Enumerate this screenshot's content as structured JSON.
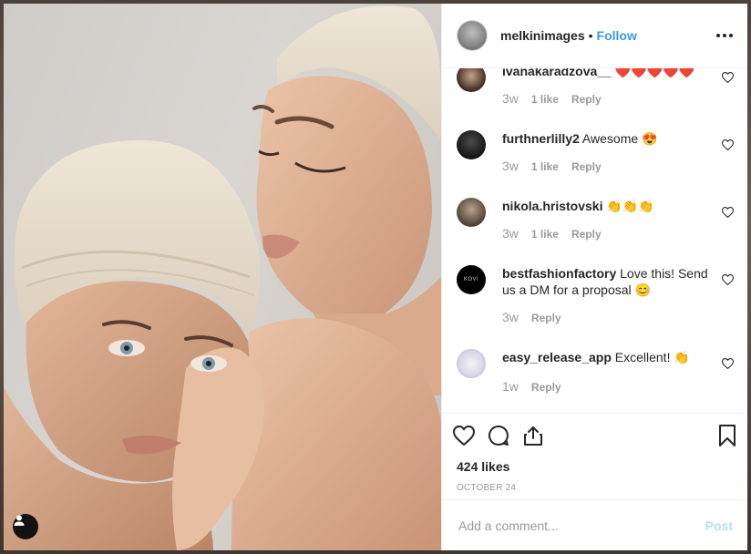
{
  "header": {
    "username": "melkinimages",
    "separator": "•",
    "follow_label": "Follow"
  },
  "comments": [
    {
      "username": "ivanakaradzova__",
      "text": "❤️❤️❤️❤️❤️",
      "time": "3w",
      "likes": "1 like",
      "reply": "Reply"
    },
    {
      "username": "furthnerlilly2",
      "text": "Awesome 😍",
      "time": "3w",
      "likes": "1 like",
      "reply": "Reply"
    },
    {
      "username": "nikola.hristovski",
      "text": "👏👏👏",
      "time": "3w",
      "likes": "1 like",
      "reply": "Reply"
    },
    {
      "username": "bestfashionfactory",
      "text": "Love this! Send us a DM for a proposal 😊",
      "time": "3w",
      "reply": "Reply"
    },
    {
      "username": "easy_release_app",
      "text": "Excellent! 👏",
      "time": "1w",
      "reply": "Reply"
    }
  ],
  "avatar_text": {
    "bestfashionfactory": "KOVI"
  },
  "icons": {
    "like": "heart-icon",
    "comment": "comment-icon",
    "share": "share-icon",
    "save": "bookmark-icon",
    "more": "more-options-icon",
    "user_tag": "user-tag-icon"
  },
  "post": {
    "likes": "424 likes",
    "date": "OCTOBER 24"
  },
  "composer": {
    "placeholder": "Add a comment...",
    "post_label": "Post"
  },
  "colors": {
    "link": "#3897f0",
    "post_disabled": "#b2dffc",
    "muted": "#999999",
    "text": "#262626"
  }
}
